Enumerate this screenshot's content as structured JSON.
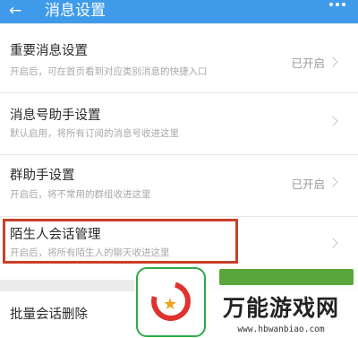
{
  "appbar": {
    "back_icon": "arrow-left-icon",
    "title": "消息设置",
    "more_icon": "more-dots-icon",
    "bg_color": "#3f9bea"
  },
  "settings": [
    {
      "title": "重要消息设置",
      "desc": "开启后，可在首页看到对应类别消息的快捷入口",
      "status": "已开启"
    },
    {
      "title": "消息号助手设置",
      "desc": "默认启用，将所有订阅的消息号收进这里",
      "status": ""
    },
    {
      "title": "群助手设置",
      "desc": "开启后，将不常用的群组收进这里",
      "status": "已开启"
    },
    {
      "title": "陌生人会话管理",
      "desc": "开启后，将所有陌生人的聊天收进这里",
      "status": ""
    },
    {
      "title": "批量会话删除",
      "desc": "",
      "status": ""
    }
  ],
  "highlight_color": "#c8402a",
  "watermark": {
    "name": "万能游戏网",
    "url": "www.hbwanbiao.com"
  }
}
